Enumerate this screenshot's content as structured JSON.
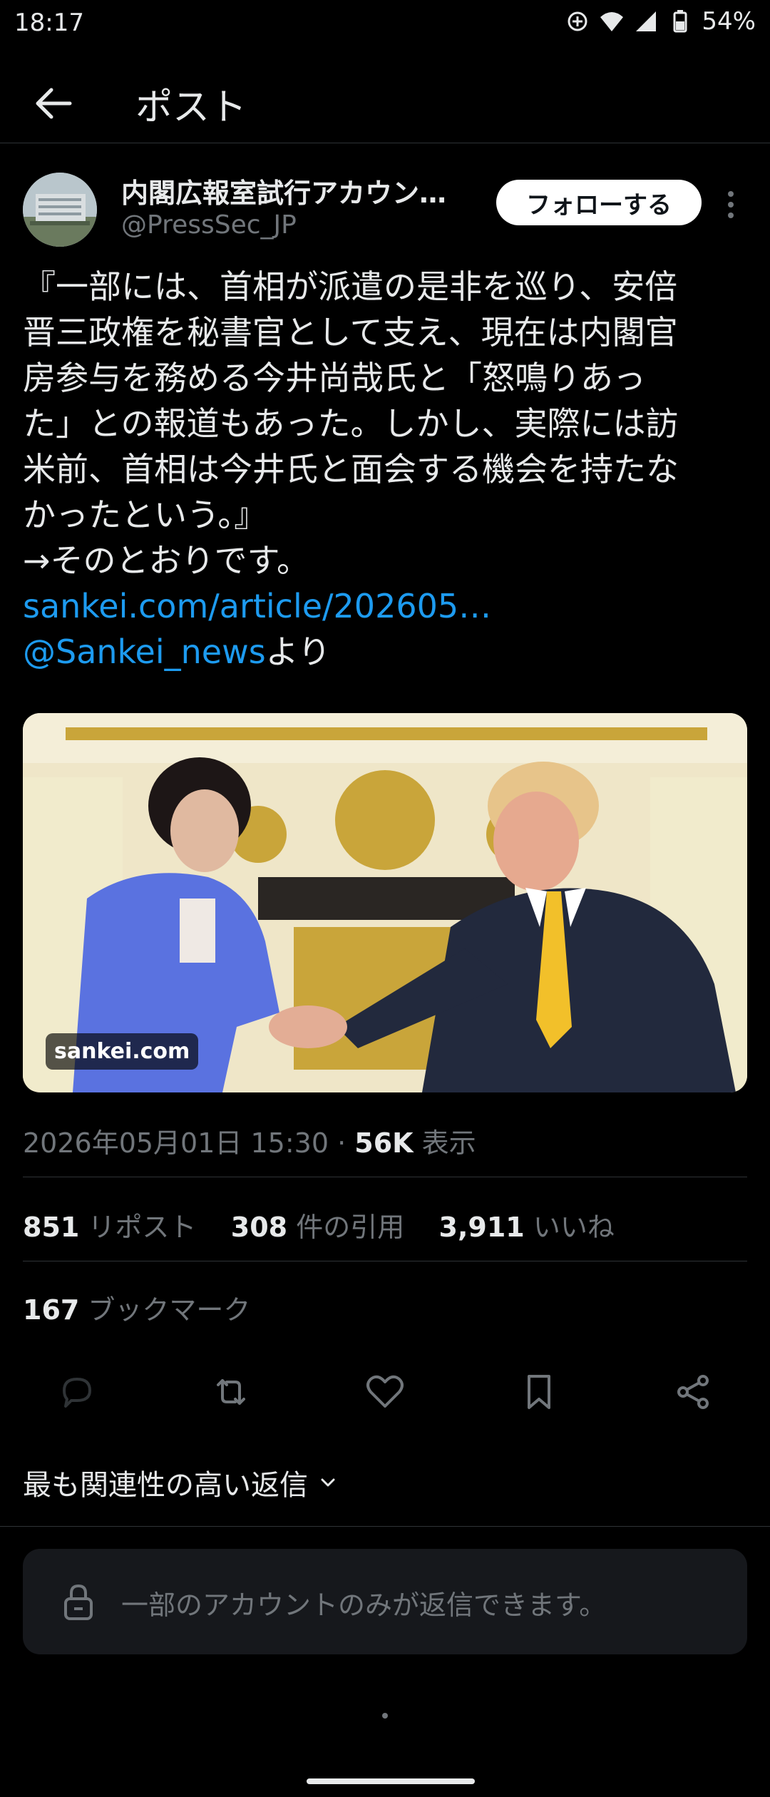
{
  "status": {
    "time": "18:17",
    "battery": "54%",
    "icons": [
      "data-saver-icon",
      "wifi-icon",
      "signal-icon",
      "battery-icon"
    ]
  },
  "header": {
    "title": "ポスト",
    "back_icon": "back-arrow-icon"
  },
  "post": {
    "author_name": "内閣広報室試行アカウン…",
    "author_handle": "@PressSec_JP",
    "follow_label": "フォローする",
    "text_lines": [
      "『一部には、首相が派遣の是非を巡り、安倍",
      "晋三政権を秘書官として支え、現在は内閣官",
      "房参与を務める今井尚哉氏と「怒鳴りあっ",
      "た」との報道もあった。しかし、実際には訪",
      "米前、首相は今井氏と面会する機会を持たな",
      "かったという。』",
      "→そのとおりです。"
    ],
    "link_text": "sankei.com/article/202605…",
    "mention": "@Sankei_news",
    "mention_suffix": "より",
    "media_tag": "sankei.com",
    "timestamp": "2026年05月01日 15:30 · ",
    "views_count": "56K",
    "views_label": " 表示"
  },
  "stats": {
    "reposts": {
      "count": "851",
      "label": "リポスト"
    },
    "quotes": {
      "count": "308",
      "label": "件の引用"
    },
    "likes": {
      "count": "3,911",
      "label": "いいね"
    },
    "bookmarks": {
      "count": "167",
      "label": "ブックマーク"
    }
  },
  "actions": [
    "reply-icon",
    "repost-icon",
    "like-icon",
    "bookmark-icon",
    "share-icon"
  ],
  "replies": {
    "sort_label": "最も関連性の高い返信",
    "restricted_text": "一部のアカウントのみが返信できます。"
  },
  "colors": {
    "background": "#000000",
    "text": "#e7e9ea",
    "muted": "#71767b",
    "link": "#1d9bf0",
    "divider": "#2f3336"
  }
}
